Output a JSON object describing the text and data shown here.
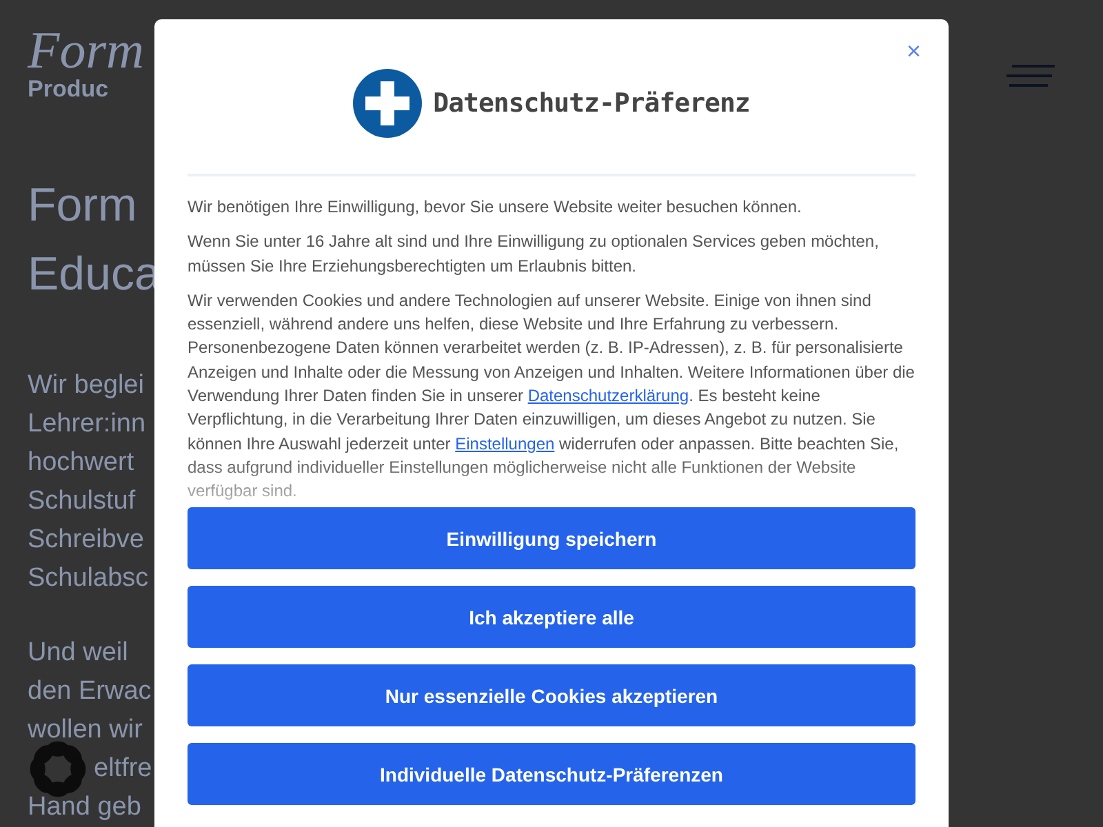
{
  "page": {
    "logo": {
      "top": "Form",
      "bottom": "Produc"
    },
    "headline": [
      "Form",
      "Educa"
    ],
    "paragraphs": [
      [
        {
          "text": "Wir beglei",
          "badge": false
        },
        {
          "text": "Lehrer:inn",
          "badge": false
        },
        {
          "text": "hochwert",
          "badge": false
        },
        {
          "text": "Schulstuf",
          "badge": false
        },
        {
          "text": "Schreibve",
          "badge": false
        },
        {
          "text": "Schulabsc",
          "badge": false
        }
      ],
      [
        {
          "text": "Und weil",
          "badge": false
        },
        {
          "text": "den Erwac",
          "badge": false
        },
        {
          "text": "wollen wir",
          "badge": false
        },
        {
          "text": "eltfre",
          "badge": true
        },
        {
          "text": "Hand geb",
          "badge": false
        }
      ]
    ]
  },
  "dialog": {
    "title": "Datenschutz-Präferenz",
    "close": "×",
    "paragraphs": [
      {
        "parts": [
          {
            "kind": "text",
            "text": "Wir benötigen Ihre Einwilligung, bevor Sie unsere Website weiter besuchen können."
          }
        ]
      },
      {
        "parts": [
          {
            "kind": "text",
            "text": "Wenn Sie unter 16 Jahre alt sind und Ihre Einwilligung zu optionalen Services geben möchten, müssen Sie Ihre Erziehungsberechtigten um Erlaubnis bitten."
          }
        ]
      },
      {
        "parts": [
          {
            "kind": "text",
            "text": "Wir verwenden Cookies und andere Technologien auf unserer Website. Einige von ihnen sind essenziell, während andere uns helfen, diese Website und Ihre Erfahrung zu verbessern. Personenbezogene Daten können verarbeitet werden (z. B. IP-Adressen), z. B. für personalisierte Anzeigen und Inhalte oder die Messung von Anzeigen und Inhalten. Weitere Informationen über die Verwendung Ihrer Daten finden Sie in unserer "
          },
          {
            "kind": "link",
            "text": "Datenschutzerklärung"
          },
          {
            "kind": "text",
            "text": ". Es besteht keine Verpflichtung, in die Verarbeitung Ihrer Daten einzuwilligen, um dieses Angebot zu nutzen. Sie können Ihre Auswahl jederzeit unter "
          },
          {
            "kind": "link",
            "text": "Einstellungen"
          },
          {
            "kind": "text",
            "text": " widerrufen oder anpassen. Bitte beachten Sie, dass aufgrund individueller Einstellungen möglicherweise nicht alle Funktionen der Website verfügbar sind."
          }
        ]
      }
    ],
    "buttons": [
      "Einwilligung speichern",
      "Ich akzeptiere alle",
      "Nur essenzielle Cookies akzeptieren",
      "Individuelle Datenschutz-Präferenzen"
    ]
  }
}
